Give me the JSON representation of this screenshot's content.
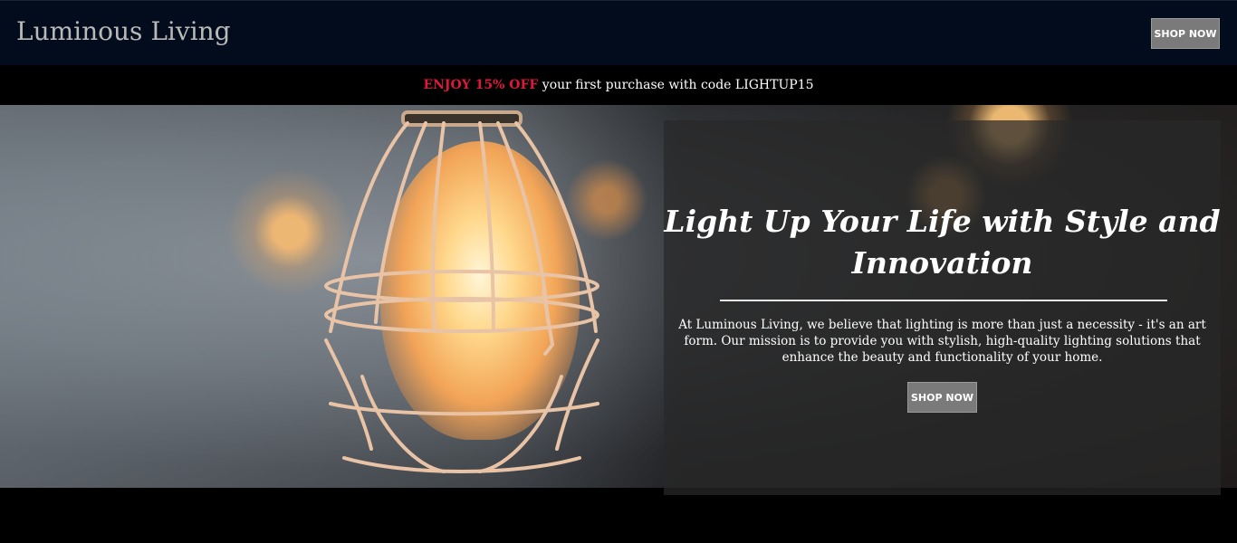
{
  "header": {
    "brand": "Luminous Living",
    "shop_now_label": "SHOP NOW"
  },
  "promo": {
    "accent": "ENJOY 15% OFF",
    "rest": " your first purchase with code LIGHTUP15"
  },
  "hero": {
    "title": "Light Up Your Life with Style and Innovation",
    "body": "At Luminous Living, we believe that lighting is more than just a necessity - it's an art form. Our mission is to provide you with stylish, high-quality lighting solutions that enhance the beauty and functionality of your home.",
    "shop_now_label": "SHOP NOW"
  },
  "colors": {
    "header_bg": "#030c1d",
    "accent": "#e0163a",
    "button_bg": "#7a7a7a"
  }
}
